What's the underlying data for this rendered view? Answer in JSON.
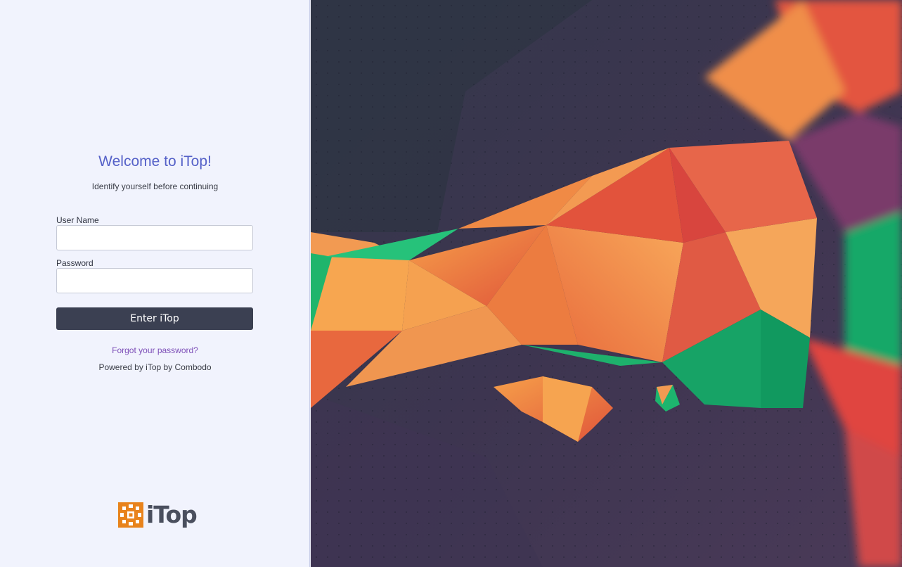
{
  "login": {
    "title": "Welcome to iTop!",
    "subtitle": "Identify yourself before continuing",
    "username_label": "User Name",
    "username_value": "",
    "password_label": "Password",
    "password_value": "",
    "submit_label": "Enter iTop",
    "forgot_link": "Forgot your password?",
    "powered_by": "Powered by iTop by Combodo"
  },
  "logo": {
    "text": "iTop",
    "icon": "itop-logo-icon"
  },
  "background": {
    "icon": "polygon-artwork"
  },
  "colors": {
    "panel_bg": "#f1f3fd",
    "title": "#5561c8",
    "button_bg": "#3b4052",
    "link": "#7d4fb8",
    "logo_orange": "#e8831c"
  }
}
